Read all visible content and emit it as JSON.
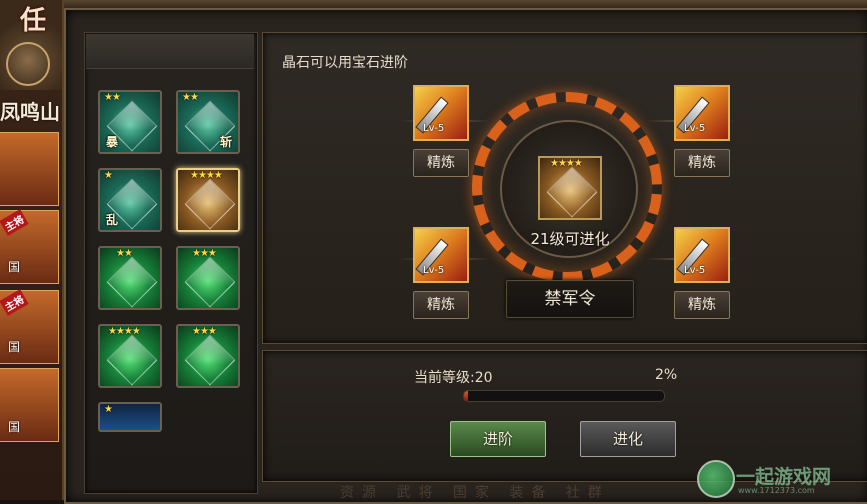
{
  "sidebar": {
    "task_char": "任",
    "location": "凤鸣山",
    "heroes": [
      {
        "tag": "",
        "faction": ""
      },
      {
        "tag": "主将",
        "faction": "国"
      },
      {
        "tag": "主将",
        "faction": "国"
      },
      {
        "tag": "",
        "faction": "国"
      }
    ]
  },
  "inventory": {
    "gems": [
      {
        "stars": "★★",
        "char": "暴",
        "color": "teal",
        "selected": false
      },
      {
        "stars": "★★",
        "char": "斩",
        "color": "teal",
        "selected": false
      },
      {
        "stars": "★",
        "char": "乱",
        "color": "teal",
        "selected": false
      },
      {
        "stars": "★★★★",
        "char": "",
        "color": "gold",
        "selected": true
      },
      {
        "stars": "★★",
        "char": "",
        "color": "green",
        "selected": false
      },
      {
        "stars": "★★★",
        "char": "",
        "color": "green",
        "selected": false
      },
      {
        "stars": "★★★★",
        "char": "",
        "color": "green",
        "selected": false
      },
      {
        "stars": "★★★",
        "char": "",
        "color": "green",
        "selected": false
      },
      {
        "stars": "★",
        "char": "",
        "color": "blue",
        "selected": false
      }
    ]
  },
  "upgrade": {
    "hint": "晶石可以用宝石进阶",
    "center_gem_stars": "★★★★",
    "center_status": "21级可进化",
    "gem_name": "禁军令",
    "equip_slots": [
      {
        "lv": "Lv-5",
        "refine_label": "精炼"
      },
      {
        "lv": "Lv-5",
        "refine_label": "精炼"
      },
      {
        "lv": "Lv-5",
        "refine_label": "精炼"
      },
      {
        "lv": "Lv-5",
        "refine_label": "精炼"
      }
    ]
  },
  "progress": {
    "level_label": "当前等级:20",
    "percent_label": "2%",
    "percent_value": 2
  },
  "actions": {
    "advance_label": "进阶",
    "evolve_label": "进化"
  },
  "background_text": "资源  武将  国家  装备  社群",
  "watermark": {
    "text": "一起游戏网",
    "sub": "www.1712373.com"
  },
  "colors": {
    "accent_orange": "#d9611b",
    "progress_fill": "#e05a2a",
    "advance_button": "#5a8a4a",
    "evolve_button": "#5a5a5a"
  }
}
